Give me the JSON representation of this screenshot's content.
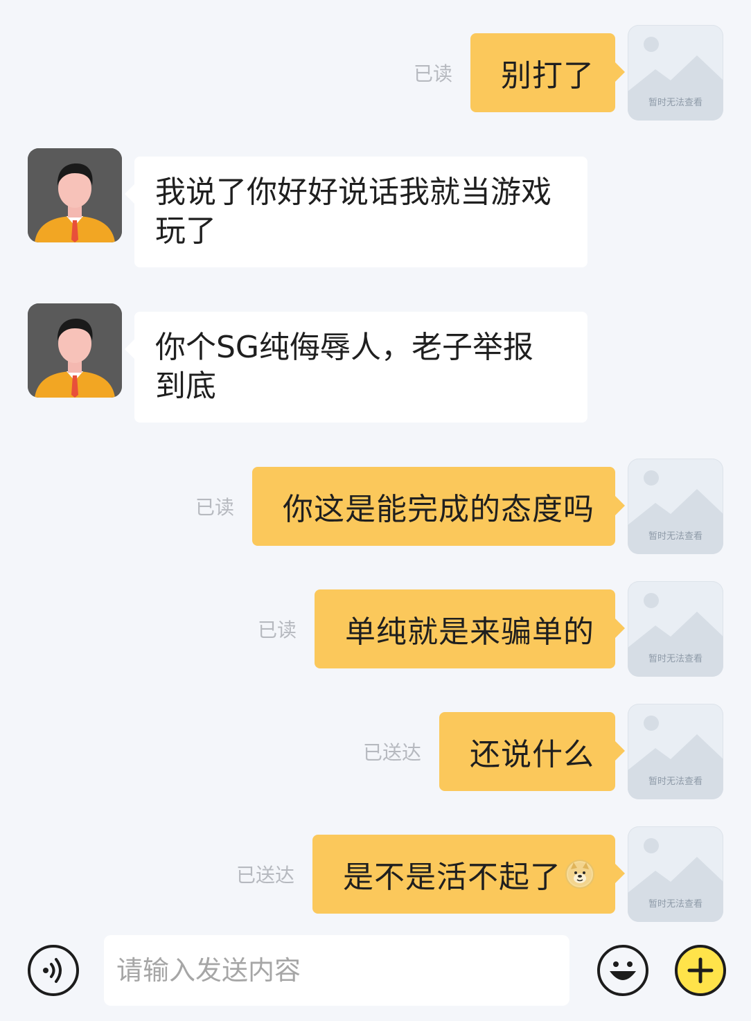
{
  "colors": {
    "accent": "#fbc85b",
    "background": "#f4f6fa",
    "incoming_bubble": "#ffffff",
    "plus_button": "#ffe34a"
  },
  "messages": [
    {
      "direction": "out",
      "status": "已读",
      "text": "别打了",
      "avatar": "placeholder",
      "avatar_caption": "暂时无法查看"
    },
    {
      "direction": "in",
      "text": "我说了你好好说话我就当游戏玩了",
      "avatar": "man-in-suit"
    },
    {
      "direction": "in",
      "text": "你个SG纯侮辱人，老子举报到底",
      "avatar": "man-in-suit"
    },
    {
      "direction": "out",
      "status": "已读",
      "text": "你这是能完成的态度吗",
      "avatar": "placeholder",
      "avatar_caption": "暂时无法查看"
    },
    {
      "direction": "out",
      "status": "已读",
      "text": "单纯就是来骗单的",
      "avatar": "placeholder",
      "avatar_caption": "暂时无法查看"
    },
    {
      "direction": "out",
      "status": "已送达",
      "text": "还说什么",
      "avatar": "placeholder",
      "avatar_caption": "暂时无法查看"
    },
    {
      "direction": "out",
      "status": "已送达",
      "text": "是不是活不起了",
      "emoji": "doge-emoji",
      "avatar": "placeholder",
      "avatar_caption": "暂时无法查看"
    }
  ],
  "input_bar": {
    "placeholder": "请输入发送内容",
    "voice_icon": "voice-icon",
    "emoji_icon": "smiley-icon",
    "plus_icon": "plus-icon"
  }
}
